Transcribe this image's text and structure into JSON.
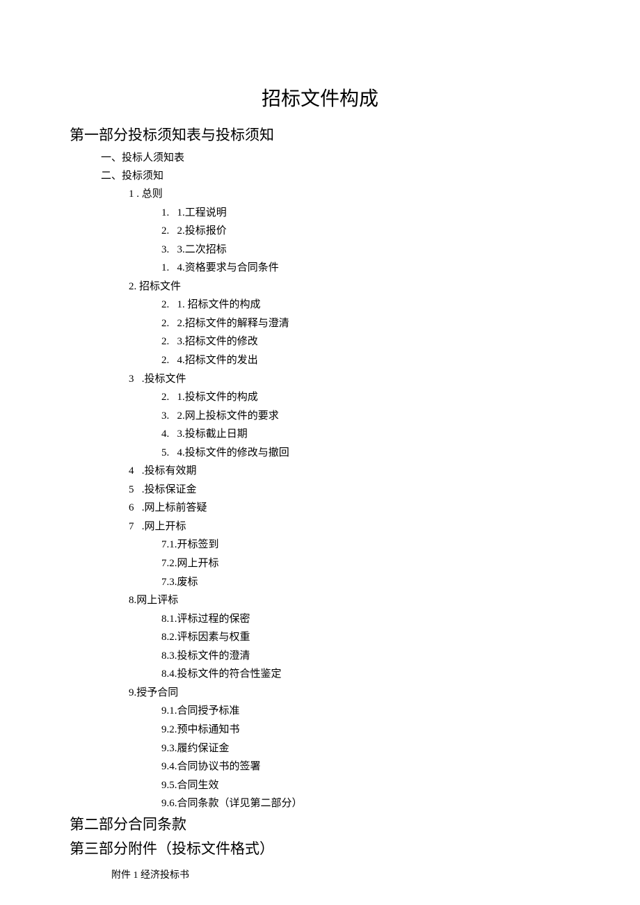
{
  "title": "招标文件构成",
  "parts": [
    {
      "heading": "第一部分投标须知表与投标须知",
      "items": [
        {
          "label": "一、投标人须知表",
          "level": 1
        },
        {
          "label": "二、投标须知",
          "level": 1
        },
        {
          "label": "1 . 总则",
          "level": 2,
          "children": [
            "1.   1.工程说明",
            "2.   2.投标报价",
            "3.   3.二次招标",
            "1.   4.资格要求与合同条件"
          ]
        },
        {
          "label": "2. 招标文件",
          "level": 2,
          "children": [
            "2.   1. 招标文件的构成",
            "2.   2.招标文件的解释与澄清",
            "2.   3.招标文件的修改",
            "2.   4.招标文件的发出"
          ]
        },
        {
          "label": "3   .投标文件",
          "level": 2,
          "children": [
            "2.   1.投标文件的构成",
            "3.   2.网上投标文件的要求",
            "4.   3.投标截止日期",
            "5.   4.投标文件的修改与撤回"
          ]
        },
        {
          "label": "4   .投标有效期",
          "level": 2
        },
        {
          "label": "5   .投标保证金",
          "level": 2
        },
        {
          "label": "6   .网上标前答疑",
          "level": 2
        },
        {
          "label": "7   .网上开标",
          "level": 2,
          "children": [
            "7.1.开标签到",
            "7.2.网上开标",
            "7.3.废标"
          ]
        },
        {
          "label": "8.网上评标",
          "level": 2,
          "children": [
            "8.1.评标过程的保密",
            "8.2.评标因素与权重",
            "8.3.投标文件的澄清",
            "8.4.投标文件的符合性鉴定"
          ]
        },
        {
          "label": "9.授予合同",
          "level": 2,
          "children": [
            "9.1.合同授予标准",
            "9.2.预中标通知书",
            "9.3.履约保证金",
            "9.4.合同协议书的签署",
            "9.5.合同生效",
            "9.6.合同条款（详见第二部分）"
          ]
        }
      ]
    },
    {
      "heading": "第二部分合同条款",
      "items": []
    },
    {
      "heading": "第三部分附件（投标文件格式）",
      "items": [
        {
          "label": "附件 1 经济投标书",
          "level": "attachment"
        }
      ]
    }
  ]
}
